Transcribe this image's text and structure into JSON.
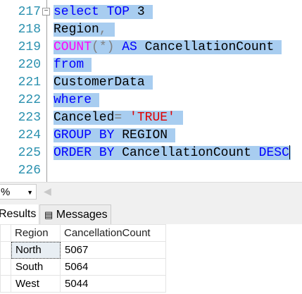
{
  "editor": {
    "line_numbers": [
      "217",
      "218",
      "219",
      "220",
      "221",
      "222",
      "223",
      "224",
      "225",
      "226"
    ],
    "lines": [
      [
        {
          "t": "select",
          "c": "kw"
        },
        {
          "t": " ",
          "c": "tx"
        },
        {
          "t": "TOP",
          "c": "kw"
        },
        {
          "t": " 3",
          "c": "tx"
        }
      ],
      [
        {
          "t": "Region",
          "c": "tx"
        },
        {
          "t": ",",
          "c": "gr"
        }
      ],
      [
        {
          "t": "COUNT",
          "c": "fn"
        },
        {
          "t": "(*)",
          "c": "gr"
        },
        {
          "t": " ",
          "c": "tx"
        },
        {
          "t": "AS",
          "c": "kw"
        },
        {
          "t": " CancellationCount",
          "c": "tx"
        }
      ],
      [
        {
          "t": "from",
          "c": "kw"
        }
      ],
      [
        {
          "t": "CustomerData",
          "c": "tx"
        }
      ],
      [
        {
          "t": "where",
          "c": "kw"
        }
      ],
      [
        {
          "t": "Canceled",
          "c": "tx"
        },
        {
          "t": "=",
          "c": "gr"
        },
        {
          "t": " ",
          "c": "tx"
        },
        {
          "t": "'TRUE'",
          "c": "str"
        }
      ],
      [
        {
          "t": "GROUP",
          "c": "kw"
        },
        {
          "t": " ",
          "c": "tx"
        },
        {
          "t": "BY",
          "c": "kw"
        },
        {
          "t": " REGION",
          "c": "tx"
        }
      ],
      [
        {
          "t": "ORDER",
          "c": "kw"
        },
        {
          "t": " ",
          "c": "tx"
        },
        {
          "t": "BY",
          "c": "kw"
        },
        {
          "t": " CancellationCount ",
          "c": "tx"
        },
        {
          "t": "DESC",
          "c": "kw"
        }
      ]
    ]
  },
  "zoom": {
    "value": "%"
  },
  "tabs": {
    "results": "Results",
    "messages": "Messages"
  },
  "grid": {
    "columns": [
      "Region",
      "CancellationCount"
    ],
    "rows": [
      [
        "North",
        "5067"
      ],
      [
        "South",
        "5064"
      ],
      [
        "West",
        "5044"
      ]
    ]
  }
}
